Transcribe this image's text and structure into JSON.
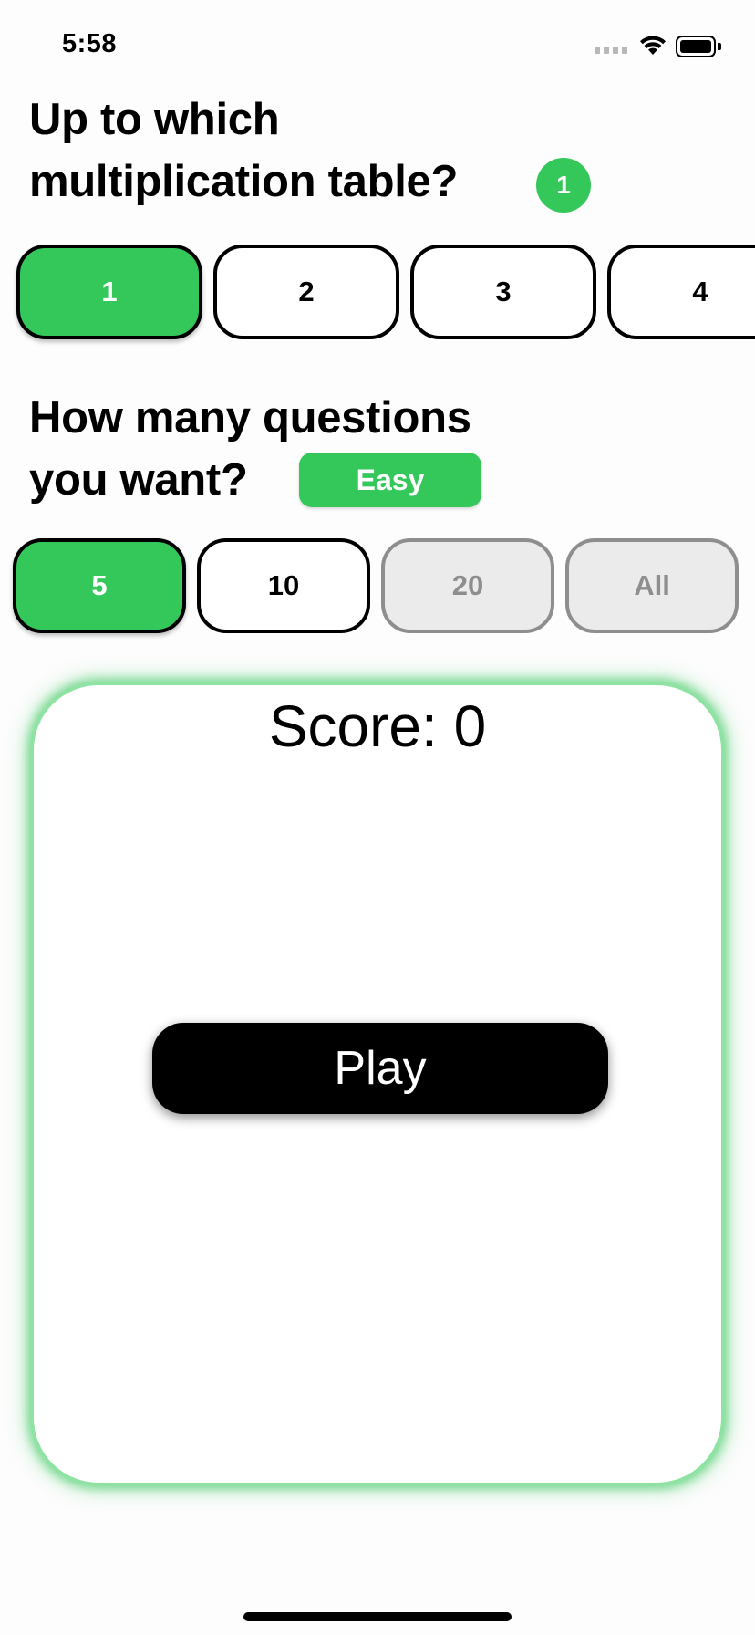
{
  "status_bar": {
    "time": "5:58",
    "signal_icon": "cellular-signal-icon",
    "wifi_icon": "wifi-icon",
    "battery_icon": "battery-full-icon"
  },
  "tables_section": {
    "heading_line1": "Up to which",
    "heading_line2": "multiplication table?",
    "selected_badge": "1",
    "options": [
      {
        "label": "1",
        "state": "selected"
      },
      {
        "label": "2",
        "state": "normal"
      },
      {
        "label": "3",
        "state": "normal"
      },
      {
        "label": "4",
        "state": "normal"
      }
    ]
  },
  "questions_section": {
    "heading_line1": "How many questions",
    "heading_line2": "you want?",
    "difficulty_badge": "Easy",
    "options": [
      {
        "label": "5",
        "state": "selected"
      },
      {
        "label": "10",
        "state": "normal"
      },
      {
        "label": "20",
        "state": "disabled"
      },
      {
        "label": "All",
        "state": "disabled"
      }
    ]
  },
  "game_card": {
    "score_label": "Score: 0",
    "play_label": "Play"
  },
  "colors": {
    "accent": "#34c759",
    "disabled": "#8e8e8e",
    "card_glow": "#34c759"
  }
}
